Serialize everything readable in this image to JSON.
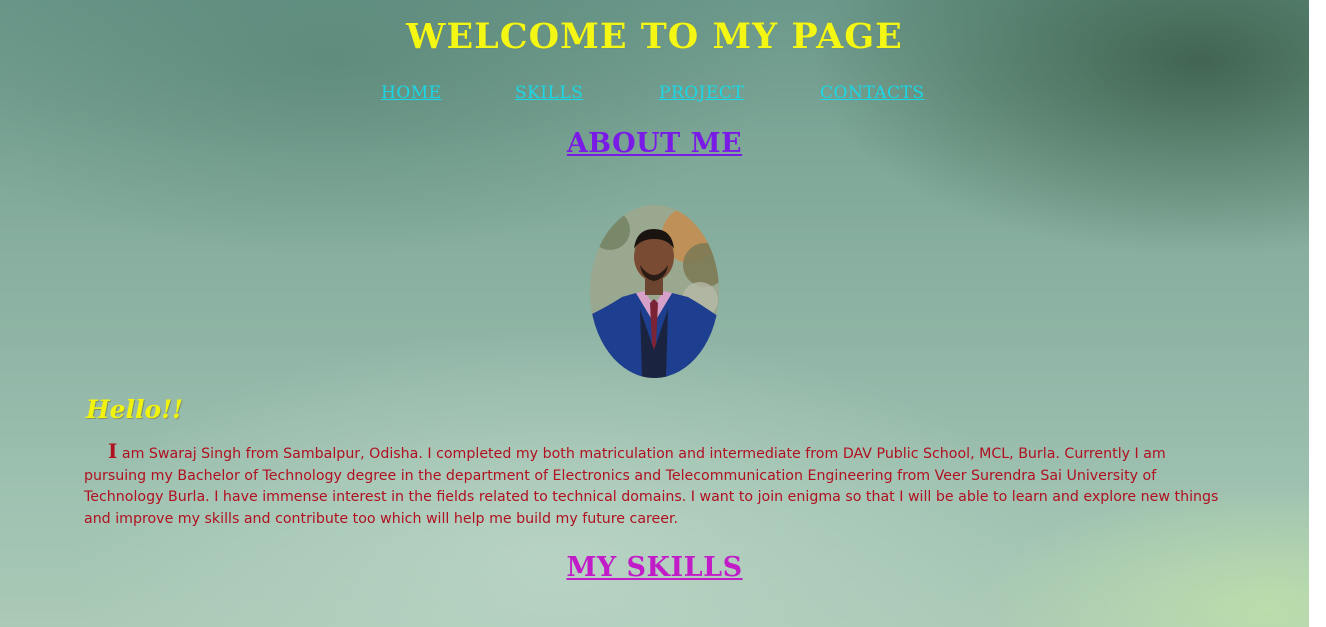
{
  "header": {
    "title": "WELCOME TO MY PAGE"
  },
  "nav": {
    "items": [
      {
        "label": "HOME"
      },
      {
        "label": "SKILLS"
      },
      {
        "label": "PROJECT"
      },
      {
        "label": "CONTACTS"
      }
    ]
  },
  "about": {
    "heading": "ABOUT ME",
    "photo_icon": "profile-photo",
    "greeting": "Hello!!",
    "bio_first_letter": "I",
    "bio_rest": " am Swaraj Singh from Sambalpur, Odisha. I completed my both matriculation and intermediate from DAV Public School, MCL, Burla. Currently I am pursuing my Bachelor of Technology degree in the department of Electronics and Telecommunication Engineering from Veer Surendra Sai University of Technology Burla. I have immense interest in the fields related to technical domains. I want to join enigma so that I will be able to learn and explore new things and improve my skills and contribute too which will help me build my future career."
  },
  "skills": {
    "heading": "MY SKILLS"
  },
  "colors": {
    "title": "#f4f713",
    "nav_link": "#19d8e8",
    "about_heading": "#7a1ae6",
    "greeting": "#f2f20f",
    "bio_text": "#b01020",
    "skills_heading": "#c21cc8"
  }
}
